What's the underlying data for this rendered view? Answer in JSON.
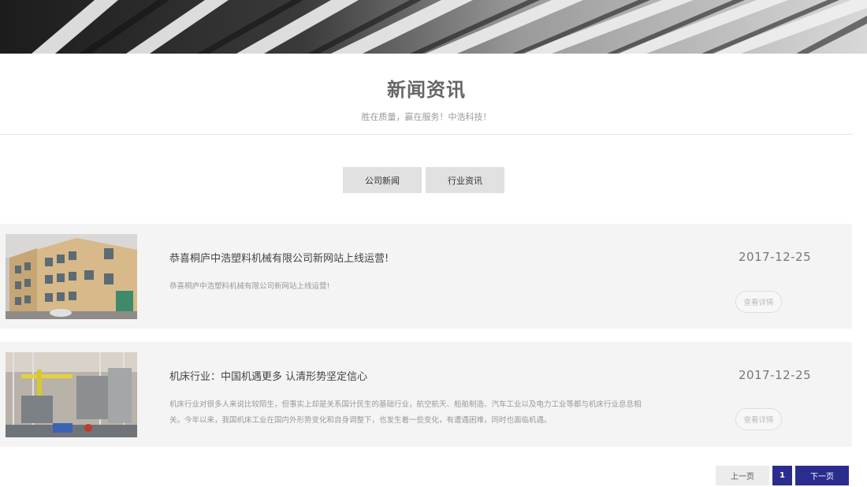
{
  "banner": {
    "alt": "abstract architecture banner"
  },
  "section": {
    "title": "新闻资讯",
    "subtitle": "胜在质量，赢在服务！中浩科技！"
  },
  "tabs": [
    {
      "label": "公司新闻"
    },
    {
      "label": "行业资讯"
    }
  ],
  "news": [
    {
      "title": "恭喜桐庐中浩塑料机械有限公司新网站上线运营!",
      "summary": "恭喜桐庐中浩塑料机械有限公司新网站上线运营!",
      "date": "2017-12-25",
      "detail_label": "查看详情"
    },
    {
      "title": "机床行业：中国机遇更多 认清形势坚定信心",
      "summary": "机床行业对很多人来说比较陌生，但事实上却是关系国计民生的基础行业，航空航天、船舶制造、汽车工业以及电力工业等都与机床行业息息相关。今年以来，我国机床工业在国内外形势变化和自身调整下，也发生着一些变化，有遭遇困难，同时也面临机遇。",
      "date": "2017-12-25",
      "detail_label": "查看详情"
    }
  ],
  "pagination": {
    "prev_label": "上一页",
    "current_page": "1",
    "next_label": "下一页"
  },
  "colors": {
    "accent": "#2a2d8e",
    "item_bg": "#f4f4f4",
    "tab_bg": "#e1e1e1"
  }
}
